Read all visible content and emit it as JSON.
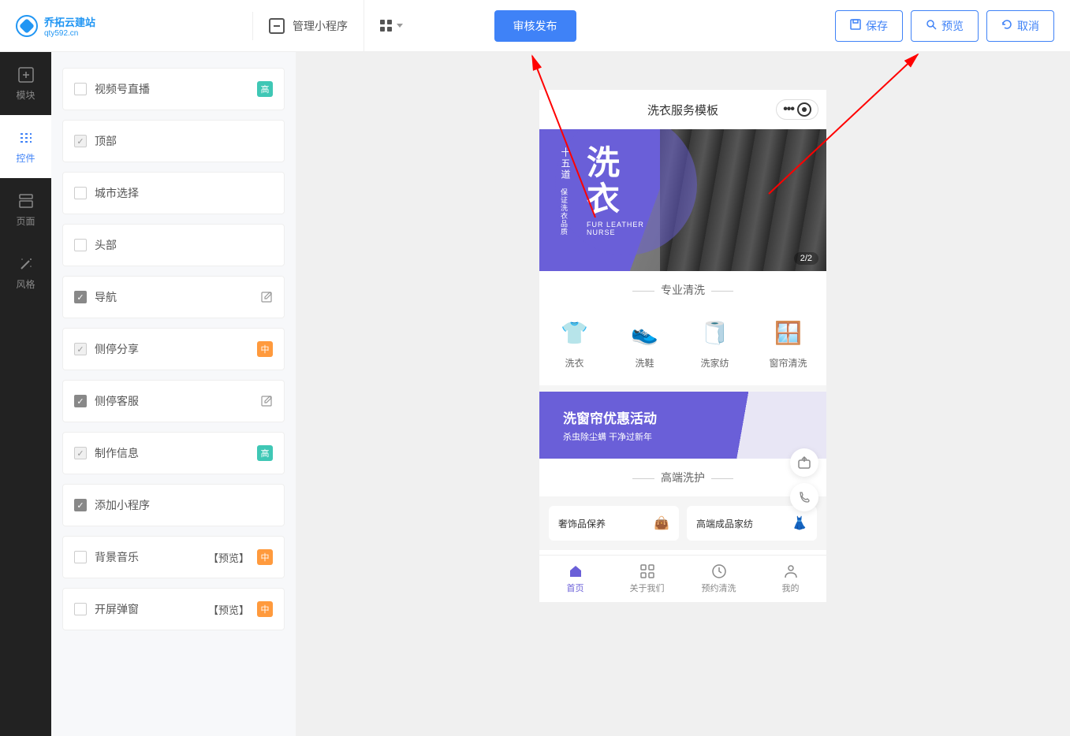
{
  "header": {
    "logo_title": "乔拓云建站",
    "logo_sub": "qty592.cn",
    "manage_text": "管理小程序",
    "publish_button": "审核发布",
    "save_button": "保存",
    "preview_button": "预览",
    "cancel_button": "取消"
  },
  "left_nav": {
    "modules": "模块",
    "controls": "控件",
    "pages": "页面",
    "style": "风格"
  },
  "controls": [
    {
      "label": "视频号直播",
      "checked": "none",
      "badge": "高",
      "badge_color": "teal"
    },
    {
      "label": "顶部",
      "checked": "light"
    },
    {
      "label": "城市选择",
      "checked": "none"
    },
    {
      "label": "头部",
      "checked": "none"
    },
    {
      "label": "导航",
      "checked": "dark",
      "edit": true
    },
    {
      "label": "侧停分享",
      "checked": "light",
      "badge": "中",
      "badge_color": "orange"
    },
    {
      "label": "侧停客服",
      "checked": "dark",
      "edit": true
    },
    {
      "label": "制作信息",
      "checked": "light",
      "badge": "高",
      "badge_color": "teal"
    },
    {
      "label": "添加小程序",
      "checked": "dark"
    },
    {
      "label": "背景音乐",
      "checked": "none",
      "preview": "【预览】",
      "badge": "中",
      "badge_color": "orange"
    },
    {
      "label": "开屏弹窗",
      "checked": "none",
      "preview": "【预览】",
      "badge": "中",
      "badge_color": "orange"
    }
  ],
  "phone": {
    "title": "洗衣服务模板",
    "banner": {
      "vert": "十五道",
      "vert2": "保证洗衣品质",
      "big_line1": "洗",
      "big_line2": "衣",
      "sub1": "FUR LEATHER",
      "sub2": "NURSE",
      "pager": "2/2"
    },
    "section1_title": "专业清洗",
    "services": [
      {
        "label": "洗衣"
      },
      {
        "label": "洗鞋"
      },
      {
        "label": "洗家纺"
      },
      {
        "label": "窗帘清洗"
      }
    ],
    "promo": {
      "title": "洗窗帘优惠活动",
      "sub": "杀虫除尘螨 干净过新年"
    },
    "section2_title": "高端洗护",
    "premium": [
      {
        "label": "奢饰品保养"
      },
      {
        "label": "高端成品家纺"
      }
    ],
    "tabbar": [
      {
        "label": "首页",
        "active": true
      },
      {
        "label": "关于我们"
      },
      {
        "label": "预约清洗"
      },
      {
        "label": "我的"
      }
    ]
  }
}
